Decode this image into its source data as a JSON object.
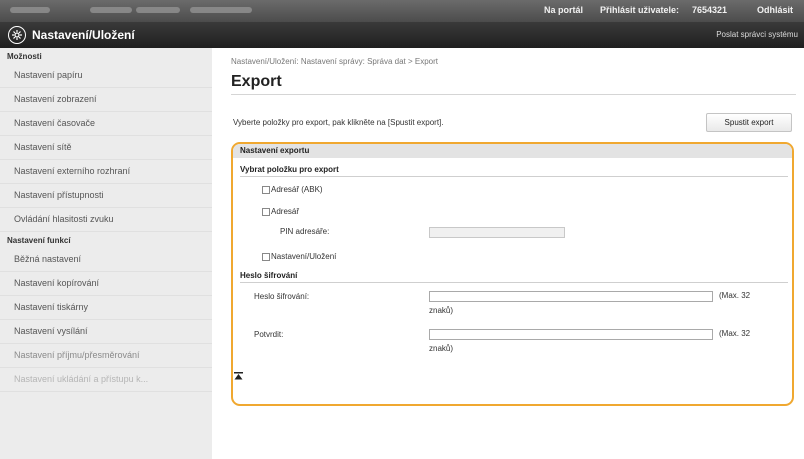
{
  "topbar": {
    "portal_link": "Na portál",
    "login_label": "Přihlásit uživatele:",
    "user_id": "7654321",
    "logout_link": "Odhlásit"
  },
  "header": {
    "title": "Nastavení/Uložení",
    "admin_link": "Poslat správci systému"
  },
  "sidebar": {
    "section1": "Možnosti",
    "items1": [
      "Nastavení papíru",
      "Nastavení zobrazení",
      "Nastavení časovače",
      "Nastavení sítě",
      "Nastavení externího rozhraní",
      "Nastavení přístupnosti",
      "Ovládání hlasitosti zvuku"
    ],
    "section2": "Nastavení funkcí",
    "items2": [
      "Běžná nastavení",
      "Nastavení kopírování",
      "Nastavení tiskárny",
      "Nastavení vysílání",
      "Nastavení příjmu/přesměrování",
      "Nastavení ukládání a přístupu k..."
    ]
  },
  "main": {
    "breadcrumb": "Nastavení/Uložení: Nastavení správy: Správa dat > Export",
    "title": "Export",
    "description": "Vyberte položky pro export, pak klikněte na [Spustit export].",
    "run_button": "Spustit export",
    "panel": {
      "header": "Nastavení exportu",
      "select_heading": "Vybrat položku pro export",
      "checkboxes": [
        "Adresář (ABK)",
        "Adresář",
        "Nastavení/Uložení"
      ],
      "pin_label": "PIN adresáře:",
      "pin_value": "",
      "pw_heading": "Heslo šifrování",
      "pw_label": "Heslo šifrování:",
      "pw_value": "",
      "confirm_label": "Potvrdit:",
      "confirm_value": "",
      "max_text_1": "(Max. 32",
      "max_text_2": "znaků)"
    },
    "to_top_icon": "to-top-icon"
  }
}
